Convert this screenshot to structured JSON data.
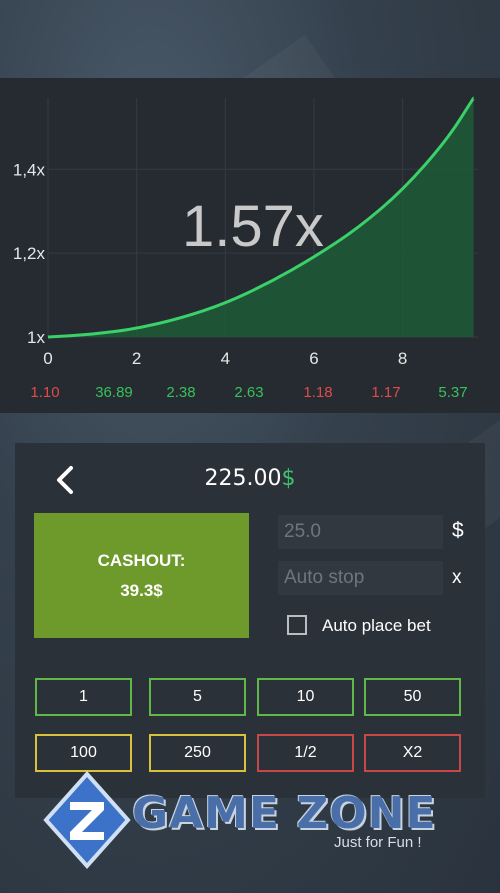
{
  "chart_data": {
    "type": "area",
    "multiplier_display": "1.57x",
    "x_ticks": [
      "0",
      "2",
      "4",
      "6",
      "8"
    ],
    "y_ticks": [
      "1x",
      "1,2x",
      "1,4x"
    ],
    "xlim": [
      0,
      9.7
    ],
    "ylim": [
      1.0,
      1.57
    ],
    "curve": {
      "x": [
        0,
        1,
        2,
        3,
        4,
        5,
        6,
        7,
        8,
        9,
        9.6
      ],
      "y": [
        1.0,
        1.006,
        1.02,
        1.045,
        1.08,
        1.13,
        1.19,
        1.26,
        1.35,
        1.47,
        1.57
      ]
    },
    "colors": {
      "line": "#3ad06a",
      "fill": "#1f5a36",
      "background": "#262b31"
    }
  },
  "history": [
    {
      "value": "1.10",
      "status": "red"
    },
    {
      "value": "36.89",
      "status": "green"
    },
    {
      "value": "2.38",
      "status": "green"
    },
    {
      "value": "2.63",
      "status": "green"
    },
    {
      "value": "1.18",
      "status": "red"
    },
    {
      "value": "1.17",
      "status": "red"
    },
    {
      "value": "5.37",
      "status": "green"
    }
  ],
  "controls": {
    "balance_value": "225.00",
    "balance_currency": "$",
    "cashout_label": "CASHOUT:",
    "cashout_amount": "39.3$",
    "bet_value": "25.0",
    "bet_suffix": "$",
    "auto_stop_placeholder": "Auto stop",
    "auto_stop_suffix": "x",
    "auto_place_label": "Auto place bet",
    "auto_place_checked": false
  },
  "bet_chips": [
    {
      "label": "1",
      "color": "green"
    },
    {
      "label": "5",
      "color": "green"
    },
    {
      "label": "10",
      "color": "green"
    },
    {
      "label": "50",
      "color": "green"
    },
    {
      "label": "100",
      "color": "yellow"
    },
    {
      "label": "250",
      "color": "yellow"
    },
    {
      "label": "1/2",
      "color": "red"
    },
    {
      "label": "X2",
      "color": "red"
    }
  ],
  "watermark": {
    "logo_text": "GAME ZONE",
    "tagline": "Just for Fun !"
  },
  "icons": {
    "back": "chevron-left-icon",
    "logo": "z-logo-icon"
  }
}
